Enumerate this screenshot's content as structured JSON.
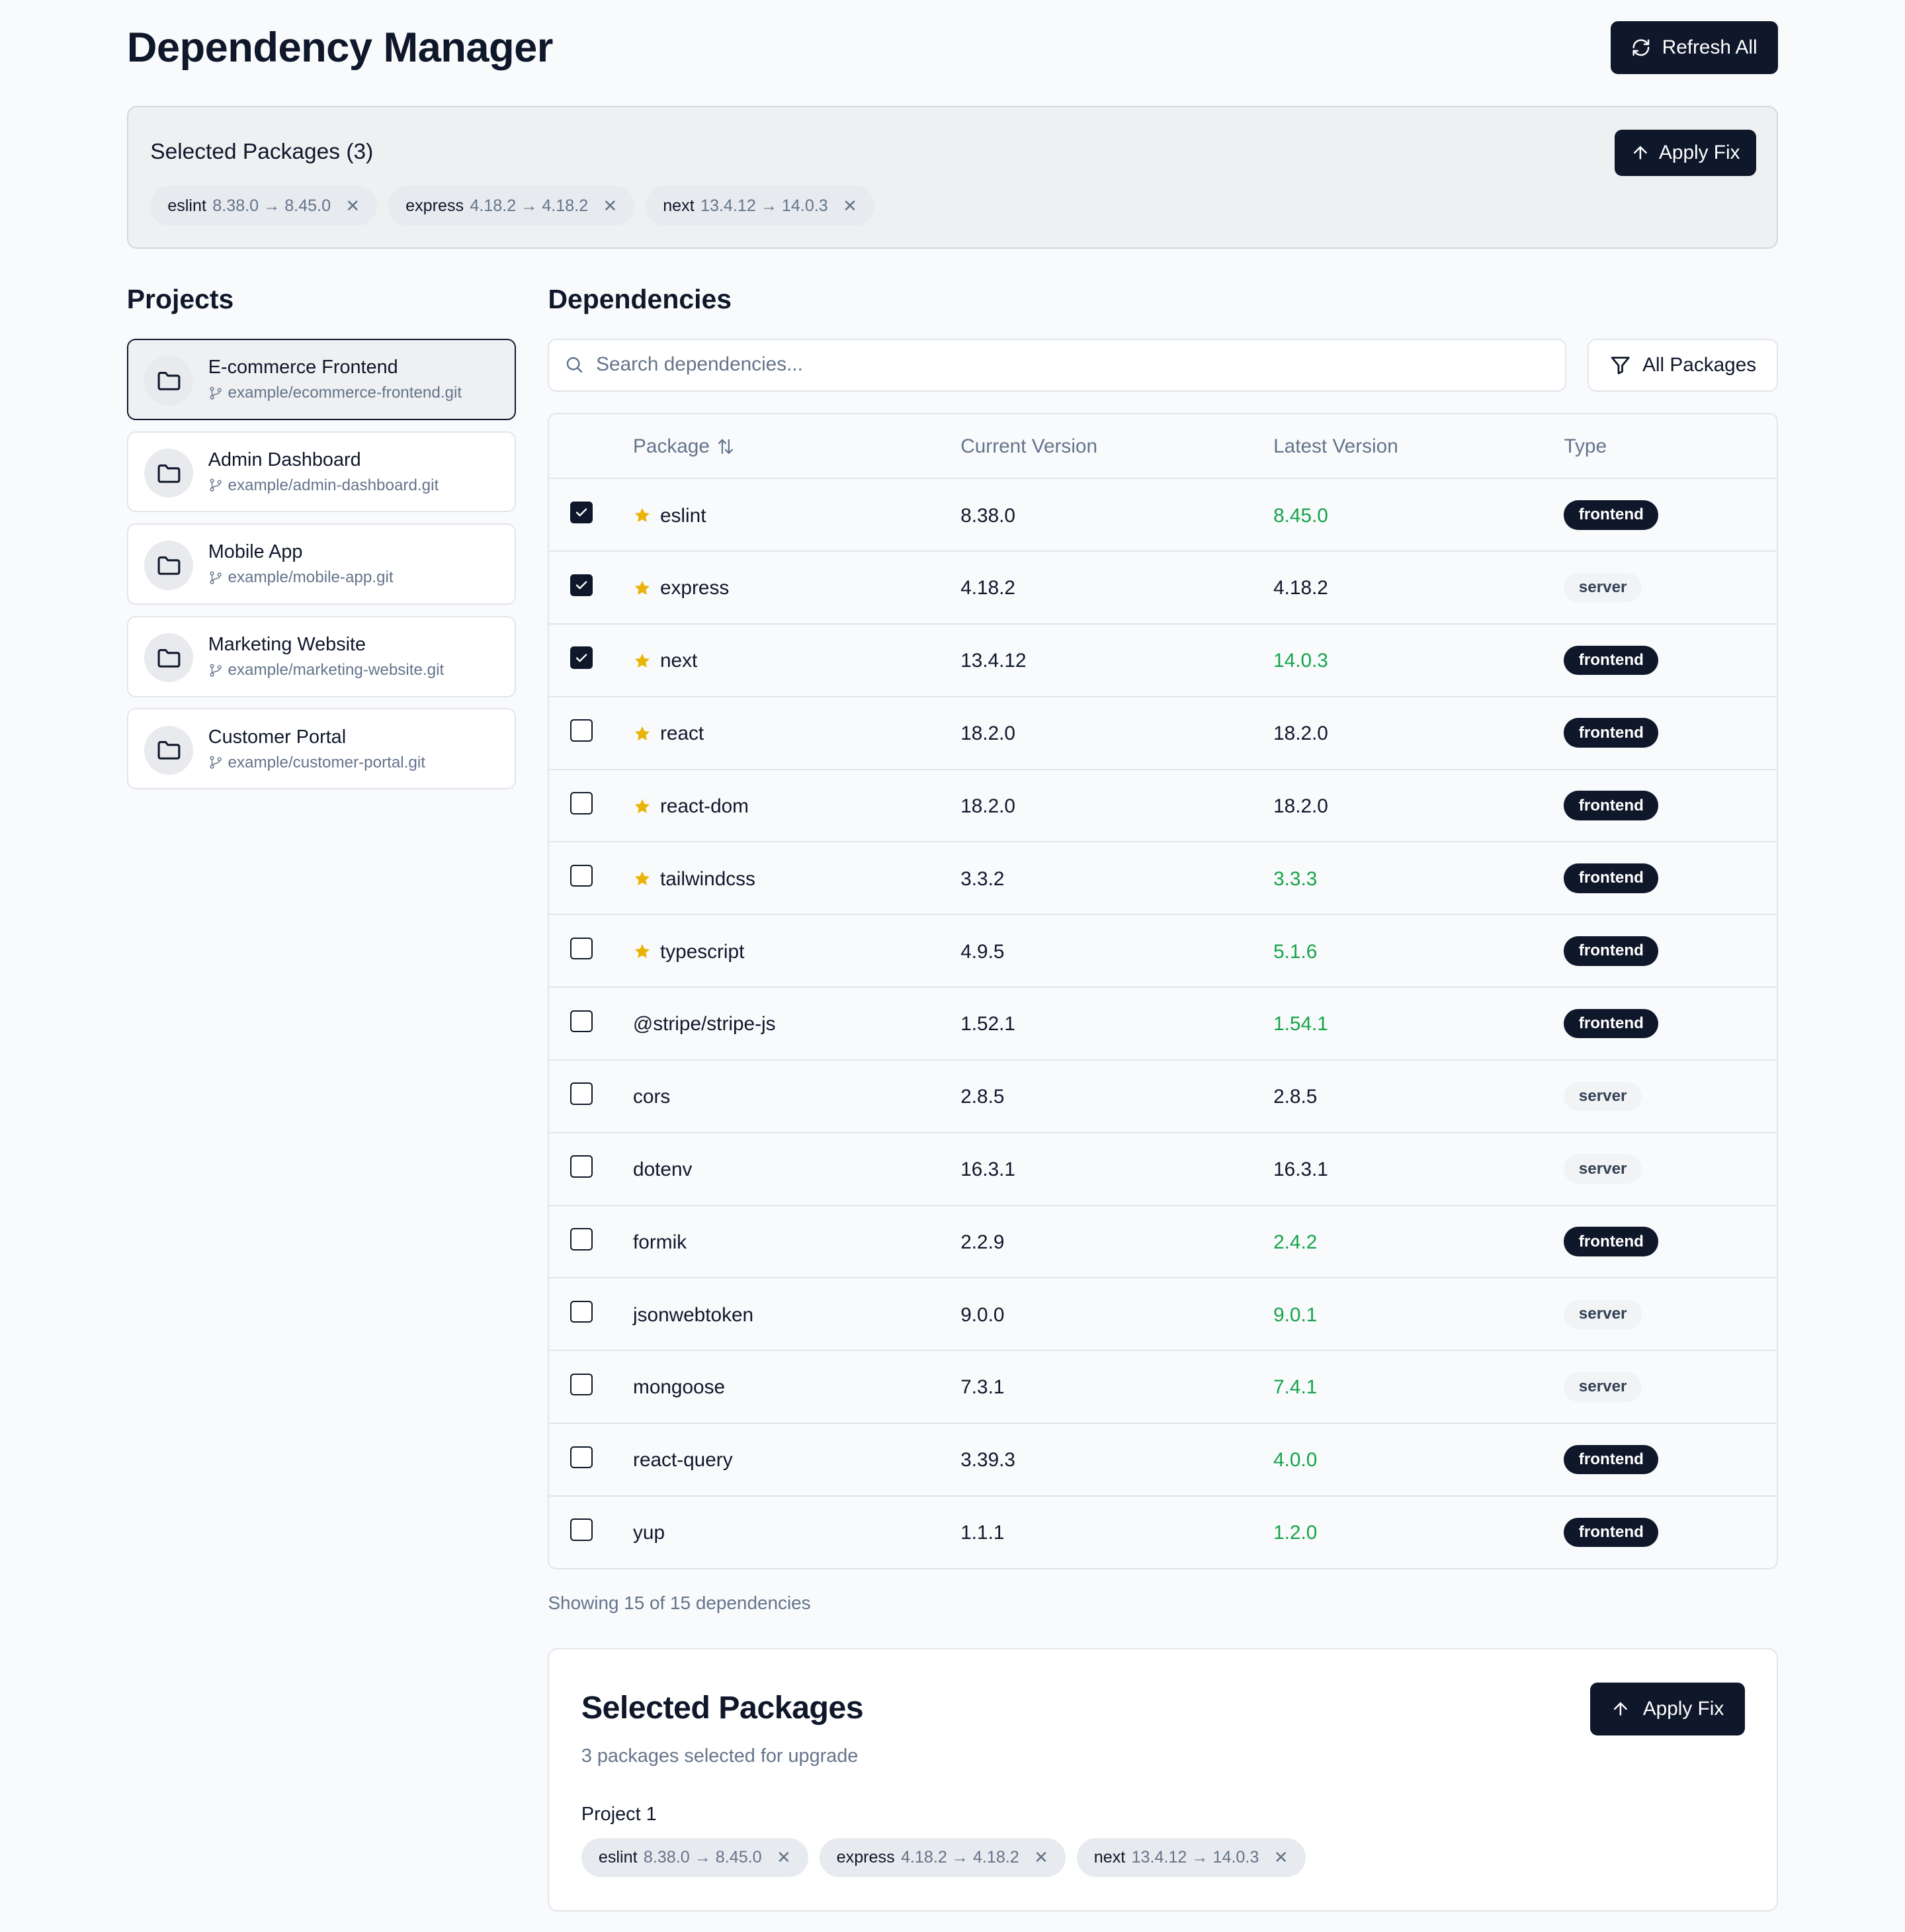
{
  "header": {
    "title": "Dependency Manager",
    "refresh_label": "Refresh All"
  },
  "selected_banner": {
    "title": "Selected Packages (3)",
    "apply_label": "Apply Fix",
    "chips": [
      {
        "name": "eslint",
        "version": "8.38.0 → 8.45.0"
      },
      {
        "name": "express",
        "version": "4.18.2 → 4.18.2"
      },
      {
        "name": "next",
        "version": "13.4.12 → 14.0.3"
      }
    ]
  },
  "projects": {
    "heading": "Projects",
    "items": [
      {
        "name": "E-commerce Frontend",
        "repo": "example/ecommerce-frontend.git",
        "active": true
      },
      {
        "name": "Admin Dashboard",
        "repo": "example/admin-dashboard.git",
        "active": false
      },
      {
        "name": "Mobile App",
        "repo": "example/mobile-app.git",
        "active": false
      },
      {
        "name": "Marketing Website",
        "repo": "example/marketing-website.git",
        "active": false
      },
      {
        "name": "Customer Portal",
        "repo": "example/customer-portal.git",
        "active": false
      }
    ]
  },
  "dependencies": {
    "heading": "Dependencies",
    "search_placeholder": "Search dependencies...",
    "filter_label": "All Packages",
    "columns": {
      "package": "Package",
      "current": "Current Version",
      "latest": "Latest Version",
      "type": "Type"
    },
    "rows": [
      {
        "name": "eslint",
        "current": "8.38.0",
        "latest": "8.45.0",
        "type": "frontend",
        "checked": true,
        "starred": true,
        "upgrade": true
      },
      {
        "name": "express",
        "current": "4.18.2",
        "latest": "4.18.2",
        "type": "server",
        "checked": true,
        "starred": true,
        "upgrade": false
      },
      {
        "name": "next",
        "current": "13.4.12",
        "latest": "14.0.3",
        "type": "frontend",
        "checked": true,
        "starred": true,
        "upgrade": true
      },
      {
        "name": "react",
        "current": "18.2.0",
        "latest": "18.2.0",
        "type": "frontend",
        "checked": false,
        "starred": true,
        "upgrade": false
      },
      {
        "name": "react-dom",
        "current": "18.2.0",
        "latest": "18.2.0",
        "type": "frontend",
        "checked": false,
        "starred": true,
        "upgrade": false
      },
      {
        "name": "tailwindcss",
        "current": "3.3.2",
        "latest": "3.3.3",
        "type": "frontend",
        "checked": false,
        "starred": true,
        "upgrade": true
      },
      {
        "name": "typescript",
        "current": "4.9.5",
        "latest": "5.1.6",
        "type": "frontend",
        "checked": false,
        "starred": true,
        "upgrade": true
      },
      {
        "name": "@stripe/stripe-js",
        "current": "1.52.1",
        "latest": "1.54.1",
        "type": "frontend",
        "checked": false,
        "starred": false,
        "upgrade": true
      },
      {
        "name": "cors",
        "current": "2.8.5",
        "latest": "2.8.5",
        "type": "server",
        "checked": false,
        "starred": false,
        "upgrade": false
      },
      {
        "name": "dotenv",
        "current": "16.3.1",
        "latest": "16.3.1",
        "type": "server",
        "checked": false,
        "starred": false,
        "upgrade": false
      },
      {
        "name": "formik",
        "current": "2.2.9",
        "latest": "2.4.2",
        "type": "frontend",
        "checked": false,
        "starred": false,
        "upgrade": true
      },
      {
        "name": "jsonwebtoken",
        "current": "9.0.0",
        "latest": "9.0.1",
        "type": "server",
        "checked": false,
        "starred": false,
        "upgrade": true
      },
      {
        "name": "mongoose",
        "current": "7.3.1",
        "latest": "7.4.1",
        "type": "server",
        "checked": false,
        "starred": false,
        "upgrade": true
      },
      {
        "name": "react-query",
        "current": "3.39.3",
        "latest": "4.0.0",
        "type": "frontend",
        "checked": false,
        "starred": false,
        "upgrade": true
      },
      {
        "name": "yup",
        "current": "1.1.1",
        "latest": "1.2.0",
        "type": "frontend",
        "checked": false,
        "starred": false,
        "upgrade": true
      }
    ],
    "showing_text": "Showing 15 of 15 dependencies"
  },
  "selected_card": {
    "title": "Selected Packages",
    "subtitle": "3 packages selected for upgrade",
    "apply_label": "Apply Fix",
    "project_label": "Project 1",
    "chips": [
      {
        "name": "eslint",
        "version": "8.38.0 → 8.45.0"
      },
      {
        "name": "express",
        "version": "4.18.2 → 4.18.2"
      },
      {
        "name": "next",
        "version": "13.4.12 → 14.0.3"
      }
    ]
  },
  "colors": {
    "primary": "#0f172a",
    "upgrade_green": "#16a34a",
    "star": "#eab308",
    "muted_text": "#64748b",
    "background": "#f8fafc"
  }
}
